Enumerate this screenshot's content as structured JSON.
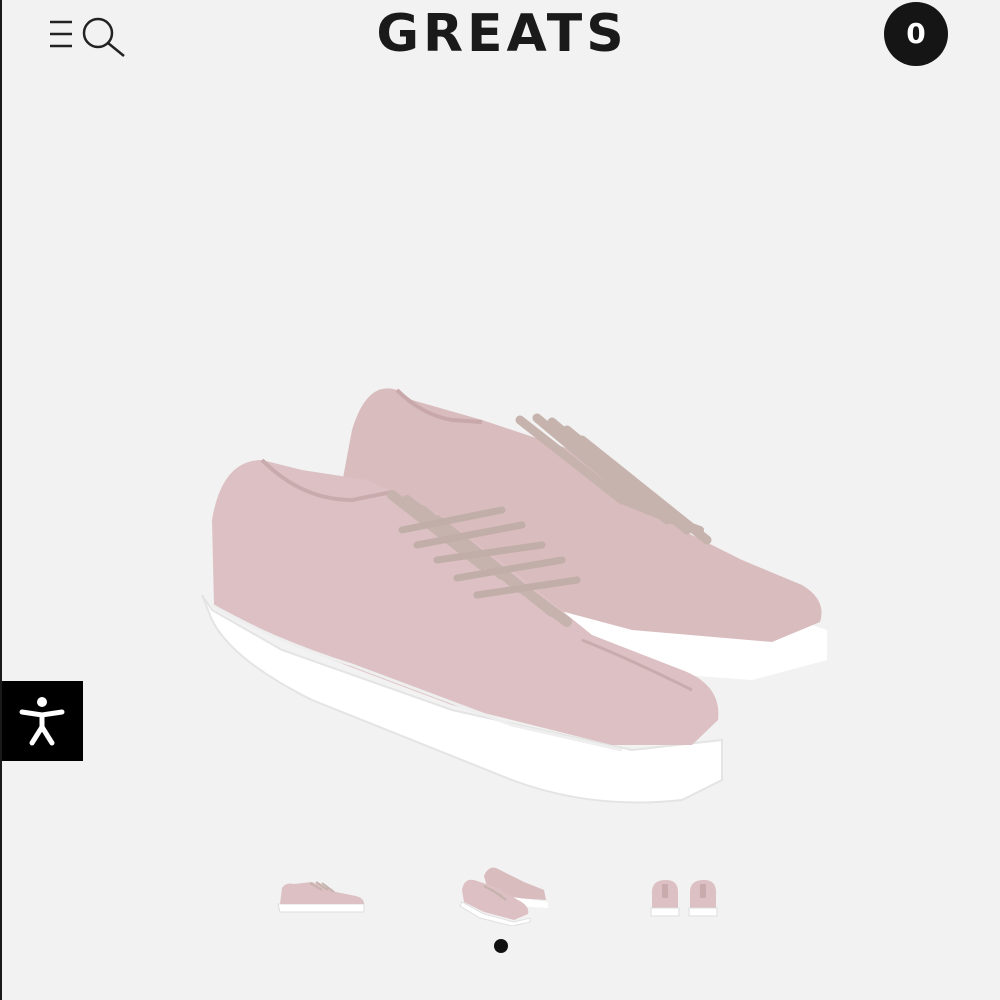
{
  "header": {
    "logo_text": "GREATS",
    "cart_count": "0",
    "menu_icon": "menu-search-icon",
    "cart_icon": "cart-count-badge"
  },
  "colors": {
    "background": "#f2f2f2",
    "shoe_pink": "#dcc0c3",
    "sole": "#ffffff",
    "lace": "#c8b7b2",
    "dark": "#151515"
  },
  "product_gallery": {
    "main_image_icon": "pink-sneaker-pair-image",
    "thumbnails": [
      {
        "icon": "sneaker-side-view-thumbnail"
      },
      {
        "icon": "sneaker-pair-angle-thumbnail"
      },
      {
        "icon": "sneaker-back-view-thumbnail"
      }
    ],
    "pagination_dots": 1,
    "active_dot": 1
  },
  "accessibility": {
    "icon": "accessibility-person-icon"
  }
}
